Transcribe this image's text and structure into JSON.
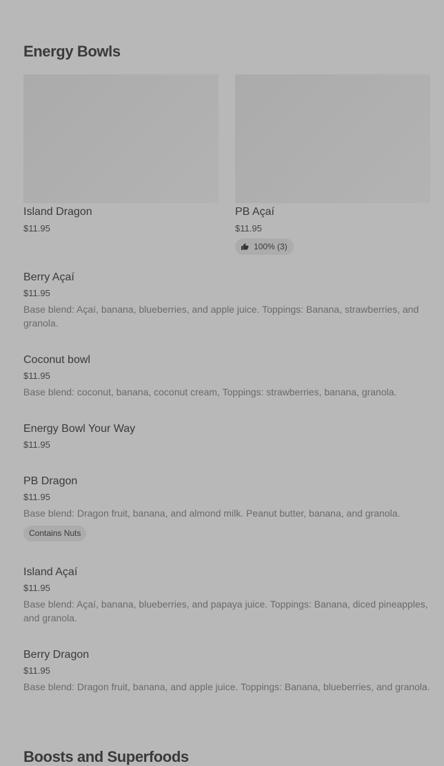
{
  "top_cut_text": "",
  "sections": [
    {
      "title": "Energy Bowls"
    },
    {
      "title": "Boosts and Superfoods"
    }
  ],
  "featured": [
    {
      "name": "Island Dragon",
      "price": "$11.95"
    },
    {
      "name": "PB Açaí",
      "price": "$11.95",
      "rating": "100% (3)",
      "rating_icon": "thumbs-up-icon"
    }
  ],
  "items": [
    {
      "name": "Berry Açaí",
      "price": "$11.95",
      "description": "Base blend: Açaí, banana, blueberries, and apple juice. Toppings: Banana, strawberries, and granola."
    },
    {
      "name": "Coconut bowl",
      "price": "$11.95",
      "description": "Base blend: coconut, banana, coconut cream, Toppings: strawberries, banana, granola."
    },
    {
      "name": "Energy Bowl Your Way",
      "price": "$11.95"
    },
    {
      "name": "PB Dragon",
      "price": "$11.95",
      "description": "Base blend: Dragon fruit, banana, and almond milk. Peanut butter, banana, and granola.",
      "tag": "Contains Nuts"
    },
    {
      "name": "Island Açaí",
      "price": "$11.95",
      "description": "Base blend: Açaí, banana, blueberries, and papaya juice. Toppings: Banana, diced pineapples, and granola."
    },
    {
      "name": "Berry Dragon",
      "price": "$11.95",
      "description": "Base blend: Dragon fruit, banana, and apple juice. Toppings: Banana, blueberries, and granola."
    }
  ]
}
